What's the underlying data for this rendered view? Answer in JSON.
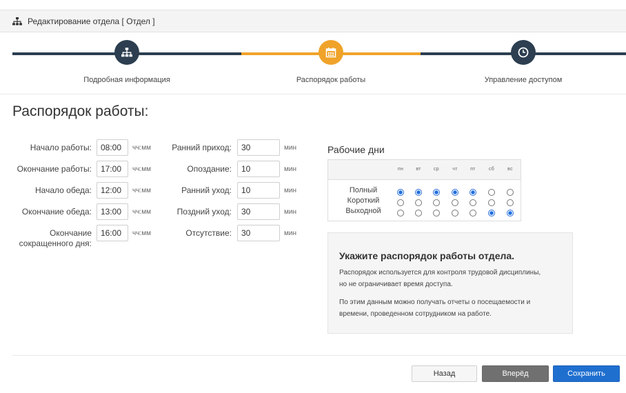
{
  "window": {
    "title": "Редактирование отдела [ Отдел ]",
    "icon": "org-chart-icon"
  },
  "wizard": {
    "colors": {
      "done": "#2c3e50",
      "active": "#f0a32a"
    },
    "steps": [
      {
        "label": "Подробная информация",
        "icon": "org-chart-icon",
        "state": "done"
      },
      {
        "label": "Распорядок работы",
        "icon": "calendar-icon",
        "state": "active"
      },
      {
        "label": "Управление доступом",
        "icon": "clock-icon",
        "state": "pending"
      }
    ]
  },
  "page": {
    "heading": "Распорядок работы:"
  },
  "schedule": {
    "unit_time": "чч:мм",
    "work_start": {
      "label": "Начало работы:",
      "value": "08:00"
    },
    "work_end": {
      "label": "Окончание работы:",
      "value": "17:00"
    },
    "lunch_start": {
      "label": "Начало обеда:",
      "value": "12:00"
    },
    "lunch_end": {
      "label": "Окончание обеда:",
      "value": "13:00"
    },
    "short_day_end": {
      "label_line1": "Окончание",
      "label_line2": "сокращенного дня:",
      "value": "16:00"
    }
  },
  "tolerances": {
    "unit": "мин",
    "early_arrival": {
      "label": "Ранний приход:",
      "value": "30"
    },
    "lateness": {
      "label": "Опоздание:",
      "value": "10"
    },
    "early_leave": {
      "label": "Ранний уход:",
      "value": "10"
    },
    "late_leave": {
      "label": "Поздний уход:",
      "value": "30"
    },
    "absence": {
      "label": "Отсутствие:",
      "value": "30"
    }
  },
  "workdays": {
    "title": "Рабочие дни",
    "days": [
      "пн",
      "вт",
      "ср",
      "чт",
      "пт",
      "сб",
      "вс"
    ],
    "types": [
      "Полный",
      "Короткий",
      "Выходной"
    ],
    "selected": [
      "Полный",
      "Полный",
      "Полный",
      "Полный",
      "Полный",
      "Выходной",
      "Выходной"
    ]
  },
  "info": {
    "title": "Укажите распорядок работы отдела.",
    "p1_line1": "Распорядок используется для контроля трудовой дисциплины,",
    "p1_line2": "но не ограничивает время доступа.",
    "p2_line1": "По этим данным можно получать отчеты о посещаемости и",
    "p2_line2": "времени, проведенном сотрудником на работе."
  },
  "buttons": {
    "back": "Назад",
    "next": "Вперёд",
    "save": "Сохранить"
  }
}
